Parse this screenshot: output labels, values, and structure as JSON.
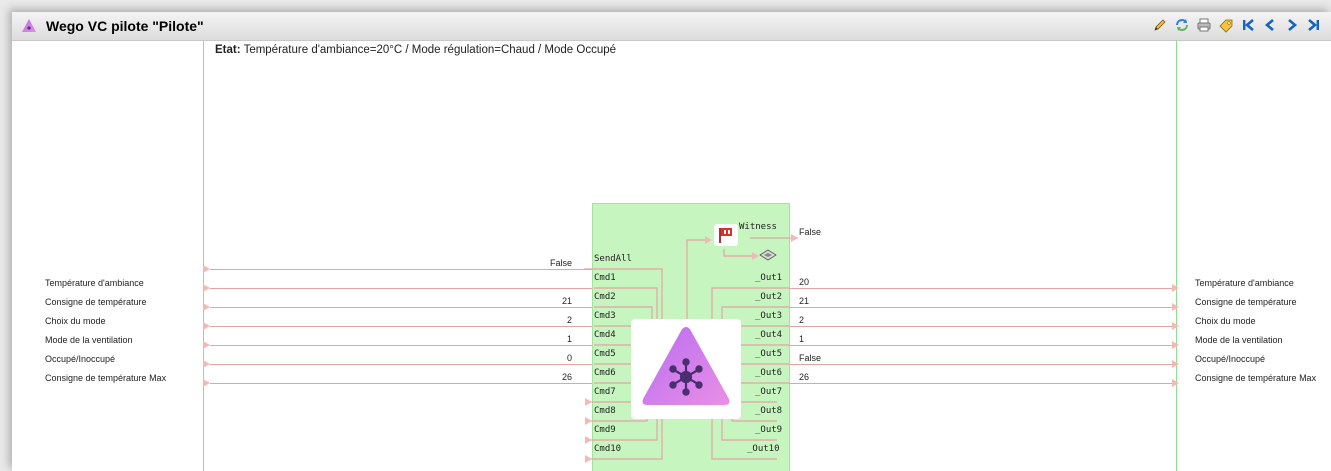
{
  "window": {
    "title": "Wego VC pilote \"Pilote\"",
    "toolbar": [
      {
        "name": "edit-icon"
      },
      {
        "name": "refresh-icon"
      },
      {
        "name": "print-icon"
      },
      {
        "name": "tag-icon"
      },
      {
        "name": "first-page-icon"
      },
      {
        "name": "previous-page-icon"
      },
      {
        "name": "next-page-icon"
      },
      {
        "name": "last-page-icon"
      }
    ]
  },
  "status": {
    "label": "Etat:",
    "text": "Température d'ambiance=20°C / Mode régulation=Chaud / Mode Occupé"
  },
  "inputs": [
    {
      "label": "",
      "value": "False",
      "pin": "SendAll"
    },
    {
      "label": "Température d'ambiance",
      "value": "",
      "pin": "Cmd1"
    },
    {
      "label": "Consigne de température",
      "value": "21",
      "pin": "Cmd2"
    },
    {
      "label": "Choix du mode",
      "value": "2",
      "pin": "Cmd3"
    },
    {
      "label": "Mode de la ventilation",
      "value": "1",
      "pin": "Cmd4"
    },
    {
      "label": "Occupé/Inoccupé",
      "value": "0",
      "pin": "Cmd5"
    },
    {
      "label": "Consigne de température Max",
      "value": "26",
      "pin": "Cmd6"
    },
    {
      "label": "",
      "value": "",
      "pin": "Cmd7"
    },
    {
      "label": "",
      "value": "",
      "pin": "Cmd8"
    },
    {
      "label": "",
      "value": "",
      "pin": "Cmd9"
    },
    {
      "label": "",
      "value": "",
      "pin": "Cmd10"
    }
  ],
  "witness": {
    "pin": "Witness",
    "value": "False"
  },
  "outputs": [
    {
      "pin": "_Out1",
      "value": "20",
      "label": "Température d'ambiance"
    },
    {
      "pin": "_Out2",
      "value": "21",
      "label": "Consigne de température"
    },
    {
      "pin": "_Out3",
      "value": "2",
      "label": "Choix du mode"
    },
    {
      "pin": "_Out4",
      "value": "1",
      "label": "Mode de la ventilation"
    },
    {
      "pin": "_Out5",
      "value": "False",
      "label": "Occupé/Inoccupé"
    },
    {
      "pin": "_Out6",
      "value": "26",
      "label": "Consigne de température Max"
    },
    {
      "pin": "_Out7",
      "value": "",
      "label": ""
    },
    {
      "pin": "_Out8",
      "value": "",
      "label": ""
    },
    {
      "pin": "_Out9",
      "value": "",
      "label": ""
    },
    {
      "pin": "_Out10",
      "value": "",
      "label": ""
    }
  ],
  "colors": {
    "block_bg": "#c7f5c0",
    "wire": "#e3a4a4",
    "icon_gradient_start": "#b86ef0",
    "icon_gradient_end": "#e58be8",
    "toolbar_nav": "#1565c0"
  }
}
